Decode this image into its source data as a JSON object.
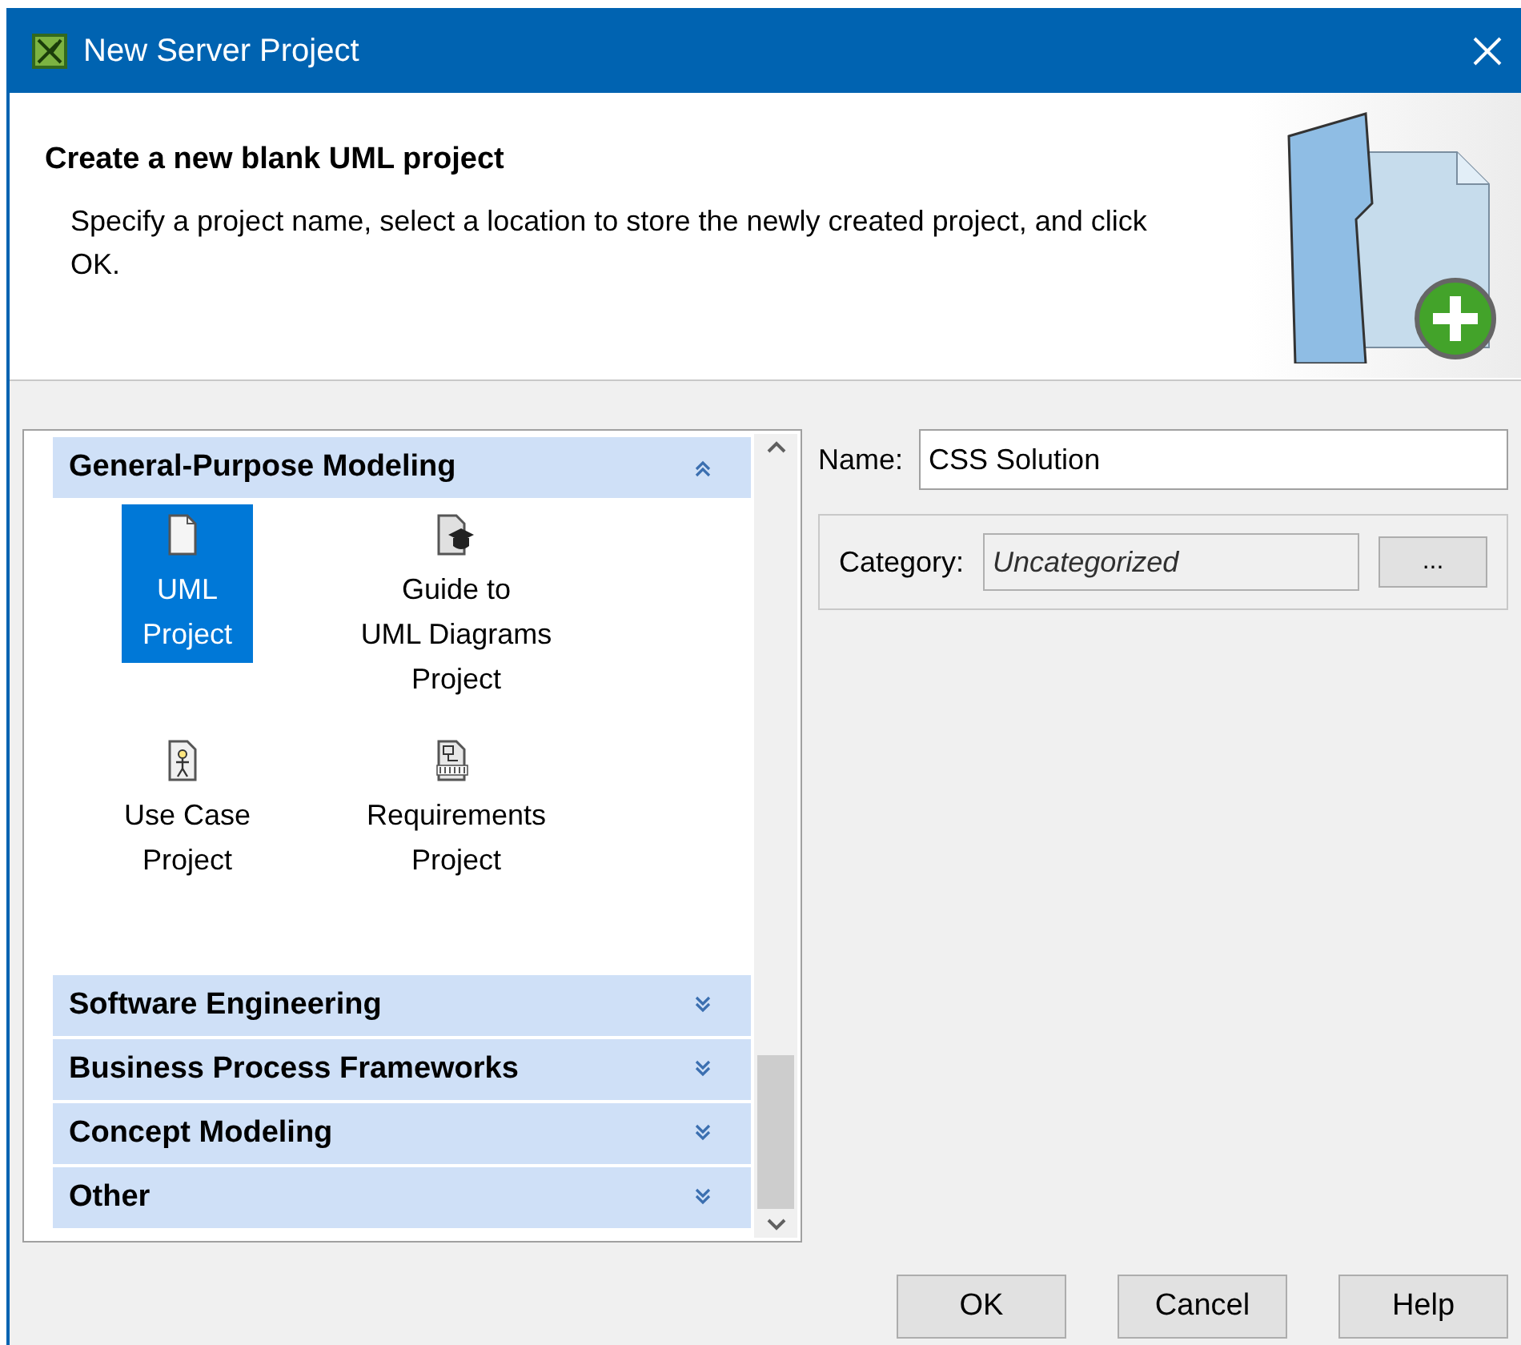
{
  "window": {
    "title": "New Server Project"
  },
  "header": {
    "title": "Create a new blank UML project",
    "description": "Specify a project name, select a location to store the newly created project, and click OK."
  },
  "categories": [
    {
      "label": "General-Purpose Modeling",
      "expanded": true,
      "items": [
        {
          "kind": "blank",
          "lines": [
            "UML",
            "Project"
          ],
          "selected": true
        },
        {
          "kind": "guide",
          "lines": [
            "Guide to",
            "UML Diagrams",
            "Project"
          ],
          "selected": false
        },
        {
          "kind": "usecase",
          "lines": [
            "Use Case",
            "Project"
          ],
          "selected": false
        },
        {
          "kind": "requirements",
          "lines": [
            "Requirements",
            "Project"
          ],
          "selected": false
        }
      ]
    },
    {
      "label": "Software Engineering",
      "expanded": false
    },
    {
      "label": "Business Process Frameworks",
      "expanded": false
    },
    {
      "label": "Concept Modeling",
      "expanded": false
    },
    {
      "label": "Other",
      "expanded": false
    }
  ],
  "name_field": {
    "label": "Name:",
    "value": "CSS Solution"
  },
  "category_field": {
    "label": "Category:",
    "value": "Uncategorized",
    "button": "..."
  },
  "buttons": [
    "OK",
    "Cancel",
    "Help"
  ]
}
